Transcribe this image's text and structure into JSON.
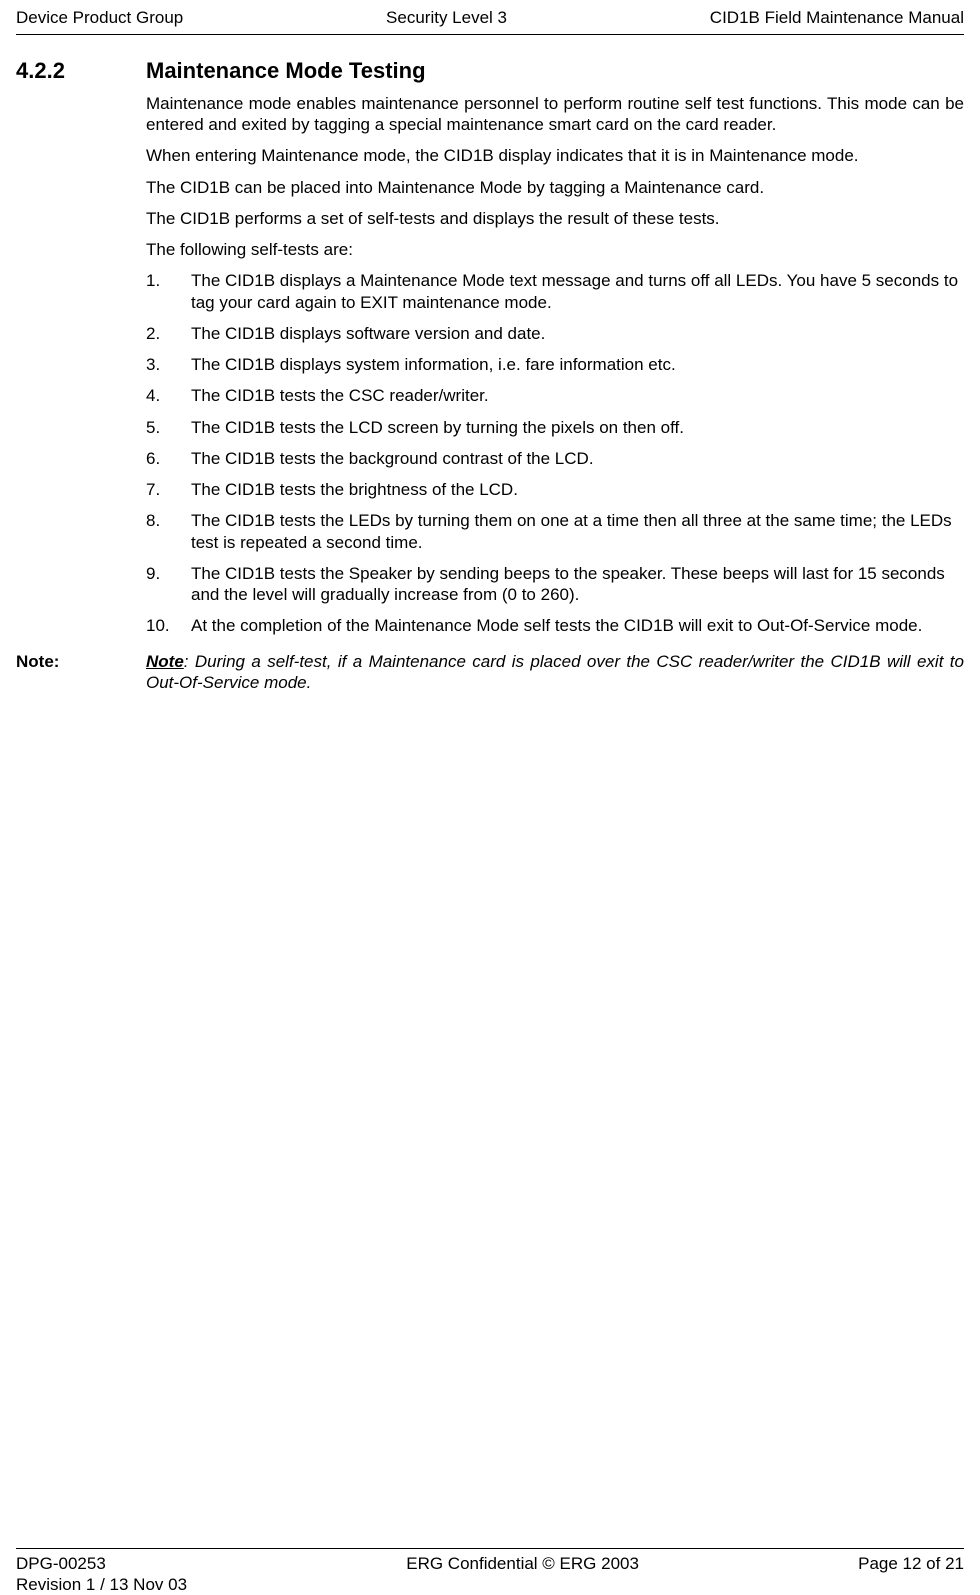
{
  "header": {
    "left": "Device Product Group",
    "center": "Security Level 3",
    "right": "CID1B Field Maintenance Manual"
  },
  "section": {
    "number": "4.2.2",
    "title": "Maintenance Mode Testing",
    "paragraphs": [
      "Maintenance mode enables maintenance personnel to perform routine self test functions. This mode can be entered and exited by tagging a special maintenance smart card on the card reader.",
      "When entering Maintenance mode, the CID1B display indicates that it is in Maintenance mode.",
      "The CID1B can be placed into Maintenance Mode by tagging a Maintenance card.",
      " The CID1B performs a set of self-tests and displays the result of these tests.",
      "The following self-tests are:"
    ],
    "list": [
      {
        "num": "1.",
        "text": "The CID1B displays a Maintenance Mode text message and turns off all LEDs. You have 5 seconds to tag your card again to EXIT maintenance mode."
      },
      {
        "num": "2.",
        "text": "The CID1B displays software version and date."
      },
      {
        "num": "3.",
        "text": "The CID1B displays system information, i.e. fare information etc."
      },
      {
        "num": "4.",
        "text": "The CID1B tests the CSC reader/writer."
      },
      {
        "num": "5.",
        "text": "The CID1B tests the LCD screen by turning the pixels on then off."
      },
      {
        "num": "6.",
        "text": "The CID1B tests the background contrast of the LCD."
      },
      {
        "num": "7.",
        "text": "The CID1B tests the brightness of the LCD."
      },
      {
        "num": "8.",
        "text": "The CID1B tests the LEDs by turning them on one at a time then all three at the same time; the LEDs test is repeated a second time."
      },
      {
        "num": "9.",
        "text": "The CID1B tests the Speaker by sending beeps to the speaker. These beeps will last for 15 seconds and the level will gradually increase from (0 to 260)."
      },
      {
        "num": "10.",
        "text": "At the completion of the Maintenance Mode self tests the CID1B will exit to Out-Of-Service mode."
      }
    ],
    "note": {
      "side_label": "Note:",
      "inline_label": "Note",
      "after_label": ":    During a self-test, if a Maintenance card is placed over the CSC reader/writer the CID1B will exit to Out-Of-Service mode."
    }
  },
  "footer": {
    "left_line1": "DPG-00253",
    "left_line2": "Revision 1 / 13 Nov 03",
    "center": "ERG Confidential © ERG 2003",
    "right": "Page 12 of 21"
  }
}
